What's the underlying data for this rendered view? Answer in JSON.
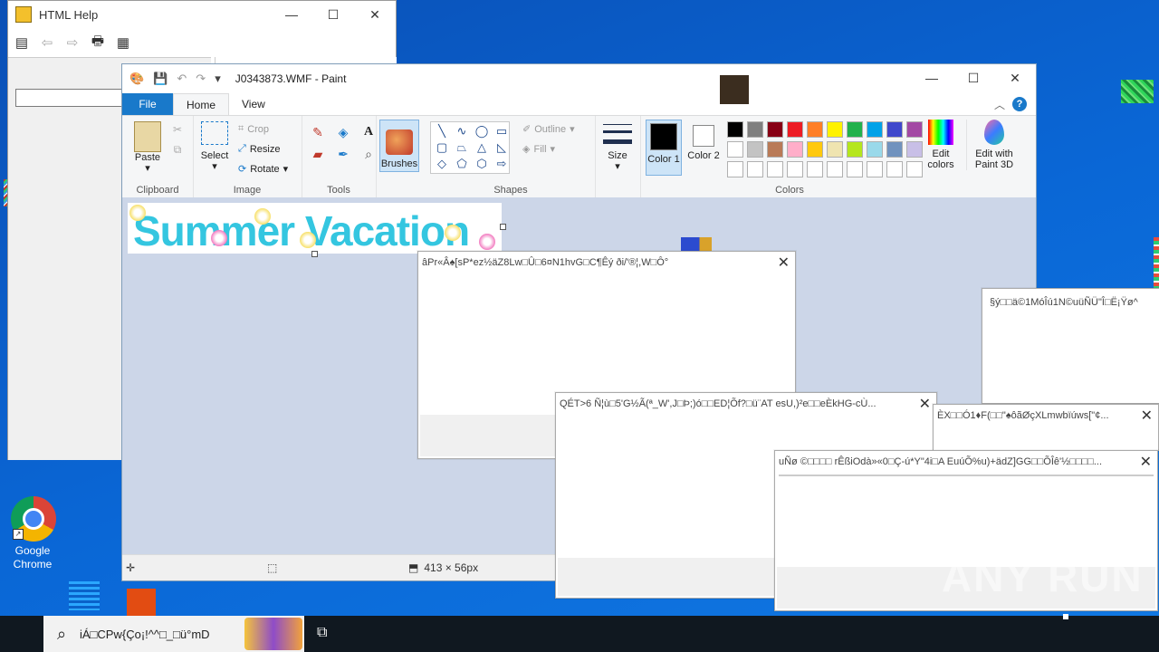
{
  "help_window": {
    "title": "HTML Help",
    "controls": {
      "minimize": "—",
      "maximize": "☐",
      "close": "✕"
    }
  },
  "paint": {
    "title": "J0343873.WMF - Paint",
    "tabs": [
      "File",
      "Home",
      "View"
    ],
    "clipboard": {
      "paste": "Paste",
      "label": "Clipboard"
    },
    "image": {
      "select": "Select",
      "crop": "Crop",
      "resize": "Resize",
      "rotate": "Rotate",
      "label": "Image"
    },
    "tools": {
      "label": "Tools"
    },
    "brushes": {
      "label": "Brushes"
    },
    "shapes": {
      "outline": "Outline",
      "fill": "Fill",
      "label": "Shapes"
    },
    "size": {
      "label": "Size"
    },
    "colors": {
      "color1": "Color 1",
      "color2": "Color 2",
      "edit_colors": "Edit colors",
      "edit_3d": "Edit with Paint 3D",
      "label": "Colors",
      "color1_value": "#000000",
      "color2_value": "#ffffff",
      "palette": [
        "#000000",
        "#7f7f7f",
        "#880015",
        "#ed1c24",
        "#ff7f27",
        "#fff200",
        "#22b14c",
        "#00a2e8",
        "#3f48cc",
        "#a349a4",
        "#ffffff",
        "#c3c3c3",
        "#b97a57",
        "#ffaec9",
        "#ffc90e",
        "#efe4b0",
        "#b5e61d",
        "#99d9ea",
        "#7092be",
        "#c8bfe7",
        "#ffffff",
        "#ffffff",
        "#ffffff",
        "#ffffff",
        "#ffffff",
        "#ffffff",
        "#ffffff",
        "#ffffff",
        "#ffffff",
        "#ffffff"
      ]
    },
    "canvas_text": "Summer Vacation",
    "status": {
      "size": "413 × 56px"
    }
  },
  "dialogs": [
    {
      "title": "âPr«Â♠[sP*ez½äZ8Lw□Û□6¤N1hvG□C¶Êý ði/'®¦,W□Ô°"
    },
    {
      "title": "§ý□□ä©1MóÎú1N©uüÑÜ\"Î□Ë¡Ÿø^"
    },
    {
      "title": "QÉT>6  Ñ¦ù□5'G½Ã(ª_W',J□Þ;)ó□□ED¦Õf?□ü¨AT esU,)²e□□eÈkHG-cÙ..."
    },
    {
      "title": "ÈX□□Ó1♦F(□□\"♠ôãØçXLmwbïúws[\"¢..."
    },
    {
      "title": "uÑø ©□□□□ rÊßiOdà»«0□Ç-ú*Y\"4i□A EuúÕ%u)+ädZ]GG□□ÕÎê'½□□□□..."
    }
  ],
  "desktop": {
    "chrome_label": "Google Chrome"
  },
  "taskbar": {
    "search_text": "iÁ□CPw{Ço¡!^^□_□ü°mD"
  },
  "watermark": "ANY RUN"
}
